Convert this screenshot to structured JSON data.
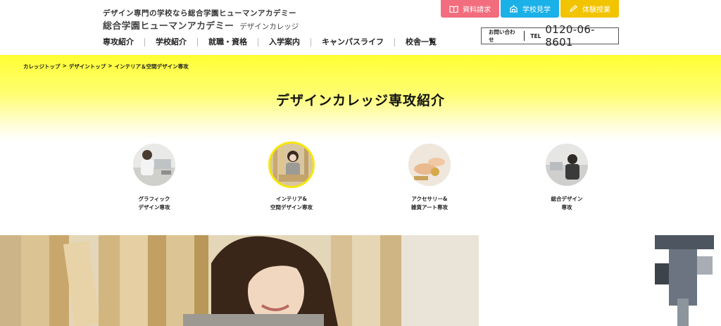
{
  "header": {
    "tagline": "デザイン専門の学校なら総合学園ヒューマンアカデミー",
    "logo_main": "総合学園ヒューマンアカデミー",
    "logo_sub": "デザインカレッジ",
    "nav": [
      "専攻紹介",
      "学校紹介",
      "就職・資格",
      "入学案内",
      "キャンパスライフ",
      "校舎一覧"
    ],
    "cta": {
      "request": "資料請求",
      "tour": "学校見学",
      "trial": "体験授業"
    },
    "contact": {
      "label": "お問い合わせ",
      "tel_label": "TEL",
      "number": "0120-06-8601"
    }
  },
  "breadcrumb": [
    "カレッジトップ",
    ">",
    "デザイントップ",
    ">",
    "インテリア＆空間デザイン専攻"
  ],
  "page_title": "デザインカレッジ専攻紹介",
  "courses": [
    {
      "line1": "グラフィック",
      "line2": "デザイン専攻"
    },
    {
      "line1": "インテリア&",
      "line2": "空間デザイン専攻"
    },
    {
      "line1": "アクセサリー&",
      "line2": "雑貨アート専攻"
    },
    {
      "line1": "総合デザイン",
      "line2": "専攻"
    }
  ],
  "colors": {
    "request": "#f26d7d",
    "tour": "#1ab0e8",
    "trial": "#f2c400",
    "hero_yellow": "#ffff33"
  }
}
